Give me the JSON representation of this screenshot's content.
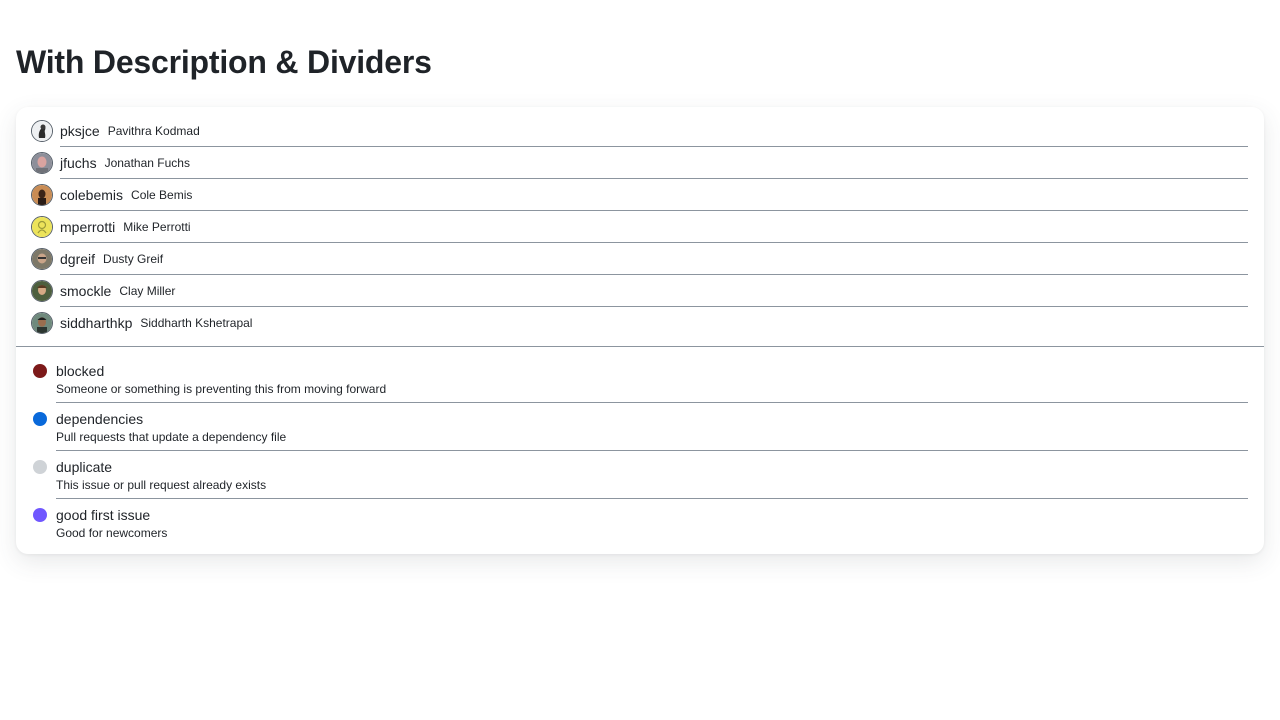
{
  "page": {
    "title": "With Description & Dividers"
  },
  "users": [
    {
      "login": "pksjce",
      "name": "Pavithra Kodmad",
      "avatar_icon": "avatar-pksjce-icon",
      "avatar_color": "#d8dde2"
    },
    {
      "login": "jfuchs",
      "name": "Jonathan Fuchs",
      "avatar_icon": "avatar-jfuchs-icon",
      "avatar_color": "#a5787b"
    },
    {
      "login": "colebemis",
      "name": "Cole Bemis",
      "avatar_icon": "avatar-colebemis-icon",
      "avatar_color": "#8a5a3b"
    },
    {
      "login": "mperrotti",
      "name": "Mike Perrotti",
      "avatar_icon": "avatar-mperrotti-icon",
      "avatar_color": "#e8df58"
    },
    {
      "login": "dgreif",
      "name": "Dusty Greif",
      "avatar_icon": "avatar-dgreif-icon",
      "avatar_color": "#8d8470"
    },
    {
      "login": "smockle",
      "name": "Clay Miller",
      "avatar_icon": "avatar-smockle-icon",
      "avatar_color": "#6b6446"
    },
    {
      "login": "siddharthkp",
      "name": "Siddharth Kshetrapal",
      "avatar_icon": "avatar-siddharthkp-icon",
      "avatar_color": "#4e6a63"
    }
  ],
  "labels": [
    {
      "name": "blocked",
      "description": "Someone or something is preventing this from moving forward",
      "color": "#7d1a1a"
    },
    {
      "name": "dependencies",
      "description": "Pull requests that update a dependency file",
      "color": "#0969da"
    },
    {
      "name": "duplicate",
      "description": "This issue or pull request already exists",
      "color": "#cfd3d7"
    },
    {
      "name": "good first issue",
      "description": "Good for newcomers",
      "color": "#7057ff"
    }
  ]
}
